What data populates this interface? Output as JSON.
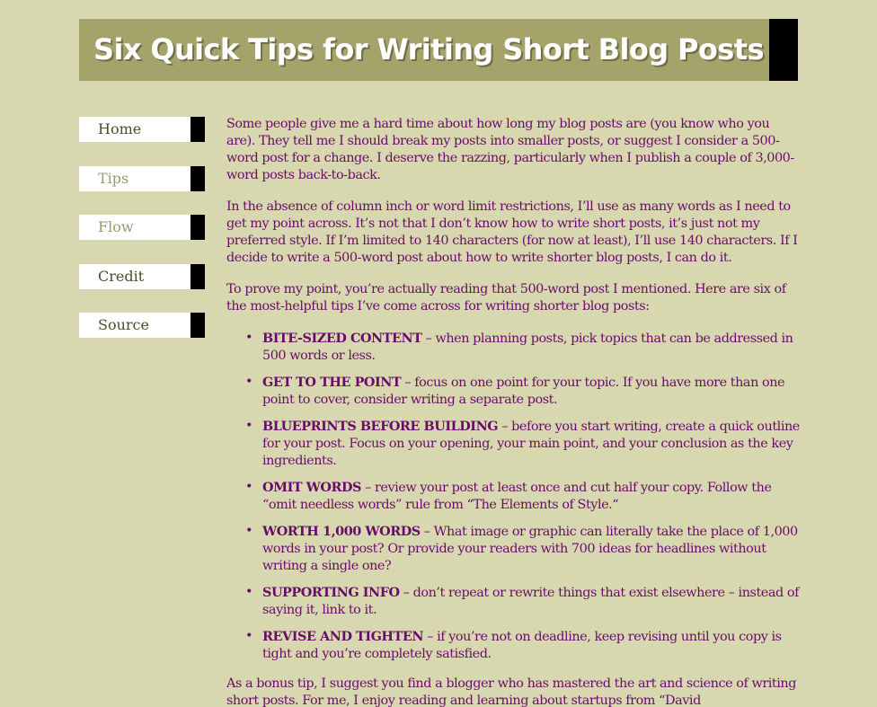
{
  "header": {
    "title": "Six Quick Tips for Writing Short Blog Posts"
  },
  "nav": {
    "items": [
      {
        "label": "Home"
      },
      {
        "label": "Tips"
      },
      {
        "label": "Flow"
      },
      {
        "label": "Credit"
      },
      {
        "label": "Source"
      }
    ]
  },
  "article": {
    "paragraphs": [
      "Some people give me a hard time about how long my blog posts are (you know who you are). They tell me I should break my posts into smaller posts, or suggest I consider a 500-word post for a change. I deserve the razzing, particularly when I publish a couple of 3,000-word posts back-to-back.",
      "In the absence of column inch or word limit restrictions, I’ll use as many words as I need to get my point across. It’s not that I don’t know how to write short posts, it’s just not my preferred style. If I’m limited to 140 characters (for now at least), I’ll use 140 characters. If I decide to write a 500-word post about how to write shorter blog posts, I can do it.",
      "To prove my point, you’re actually reading that 500-word post I mentioned. Here are six of the most-helpful tips I’ve come across for writing shorter blog posts:"
    ],
    "tips": [
      {
        "name": "Bite-sized content",
        "text": " – when planning posts, pick topics that can be addressed in 500 words or less."
      },
      {
        "name": "Get to the point",
        "text": " – focus on one point for your topic. If you have more than one point to cover, consider writing a separate post."
      },
      {
        "name": "Blueprints before building",
        "text": " – before you start writing, create a quick outline for your post. Focus on your opening, your main point, and your conclusion as the key ingredients."
      },
      {
        "name": "Omit words",
        "text": " – review your post at least once and cut half your copy. Follow the “omit needless words” rule from “The Elements of Style.“"
      },
      {
        "name": "Worth 1,000 words",
        "text": " – What image or graphic can literally take the place of 1,000 words in your post? Or provide your readers with 700 ideas for headlines without writing a single one?"
      },
      {
        "name": "Supporting info",
        "text": " – don’t repeat or rewrite things that exist elsewhere – instead of saying it, link to it."
      },
      {
        "name": "Revise and tighten",
        "text": " – if you’re not on deadline, keep revising until you copy is tight and you’re completely satisfied."
      }
    ],
    "closing": "As a bonus tip, I suggest you find a blogger who has mastered the art and science of writing short posts. For me, I enjoy reading and learning about startups from “David"
  },
  "colors": {
    "page_background": "#d8d8b0",
    "banner_background": "#a3a36a",
    "body_text": "#6a0b6a",
    "nav_dark_text": "#4d4d2c",
    "nav_light_text": "#9b9b6a",
    "accent_block": "#000000"
  }
}
